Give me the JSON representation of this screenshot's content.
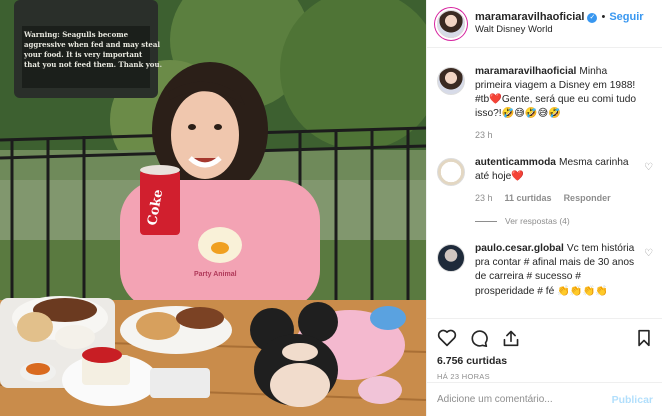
{
  "photo": {
    "sign_text": "Warning: Seagulls become aggressive when fed and may steal your food. It is very important that you not feed them. Thank you.",
    "cup_text": "Coke",
    "shirt_text": "Party Animal"
  },
  "header": {
    "username": "maramaravilhaoficial",
    "follow_label": "Seguir",
    "separator": "•",
    "location": "Walt Disney World"
  },
  "caption": {
    "username": "maramaravilhaoficial",
    "text": "Minha primeira viagem a Disney em 1988! #tb❤️Gente, será que eu comi tudo isso?!🤣😅🤣😅🤣",
    "time": "23 h"
  },
  "comments": [
    {
      "username": "autenticammoda",
      "text": "Mesma carinha até hoje❤️",
      "time": "23 h",
      "likes": "11 curtidas",
      "reply_label": "Responder",
      "view_replies": "Ver respostas (4)"
    },
    {
      "username": "paulo.cesar.global",
      "text": "Vc tem história pra contar # afinal mais de 30 anos de carreira # sucesso # prosperidade # fé 👏👏👏👏"
    }
  ],
  "actions": {
    "likes": "6.756 curtidas",
    "time_ago": "HÁ 23 HORAS"
  },
  "add_comment": {
    "placeholder": "Adicione um comentário...",
    "publish_label": "Publicar"
  },
  "colors": {
    "link": "#3897f0",
    "verified": "#3897f0",
    "publish_disabled": "#b2dffc",
    "muted": "#8e8e8e"
  },
  "icons": [
    "verified-badge-icon",
    "heart-icon",
    "comment-icon",
    "share-icon",
    "bookmark-icon",
    "small-heart-icon"
  ]
}
